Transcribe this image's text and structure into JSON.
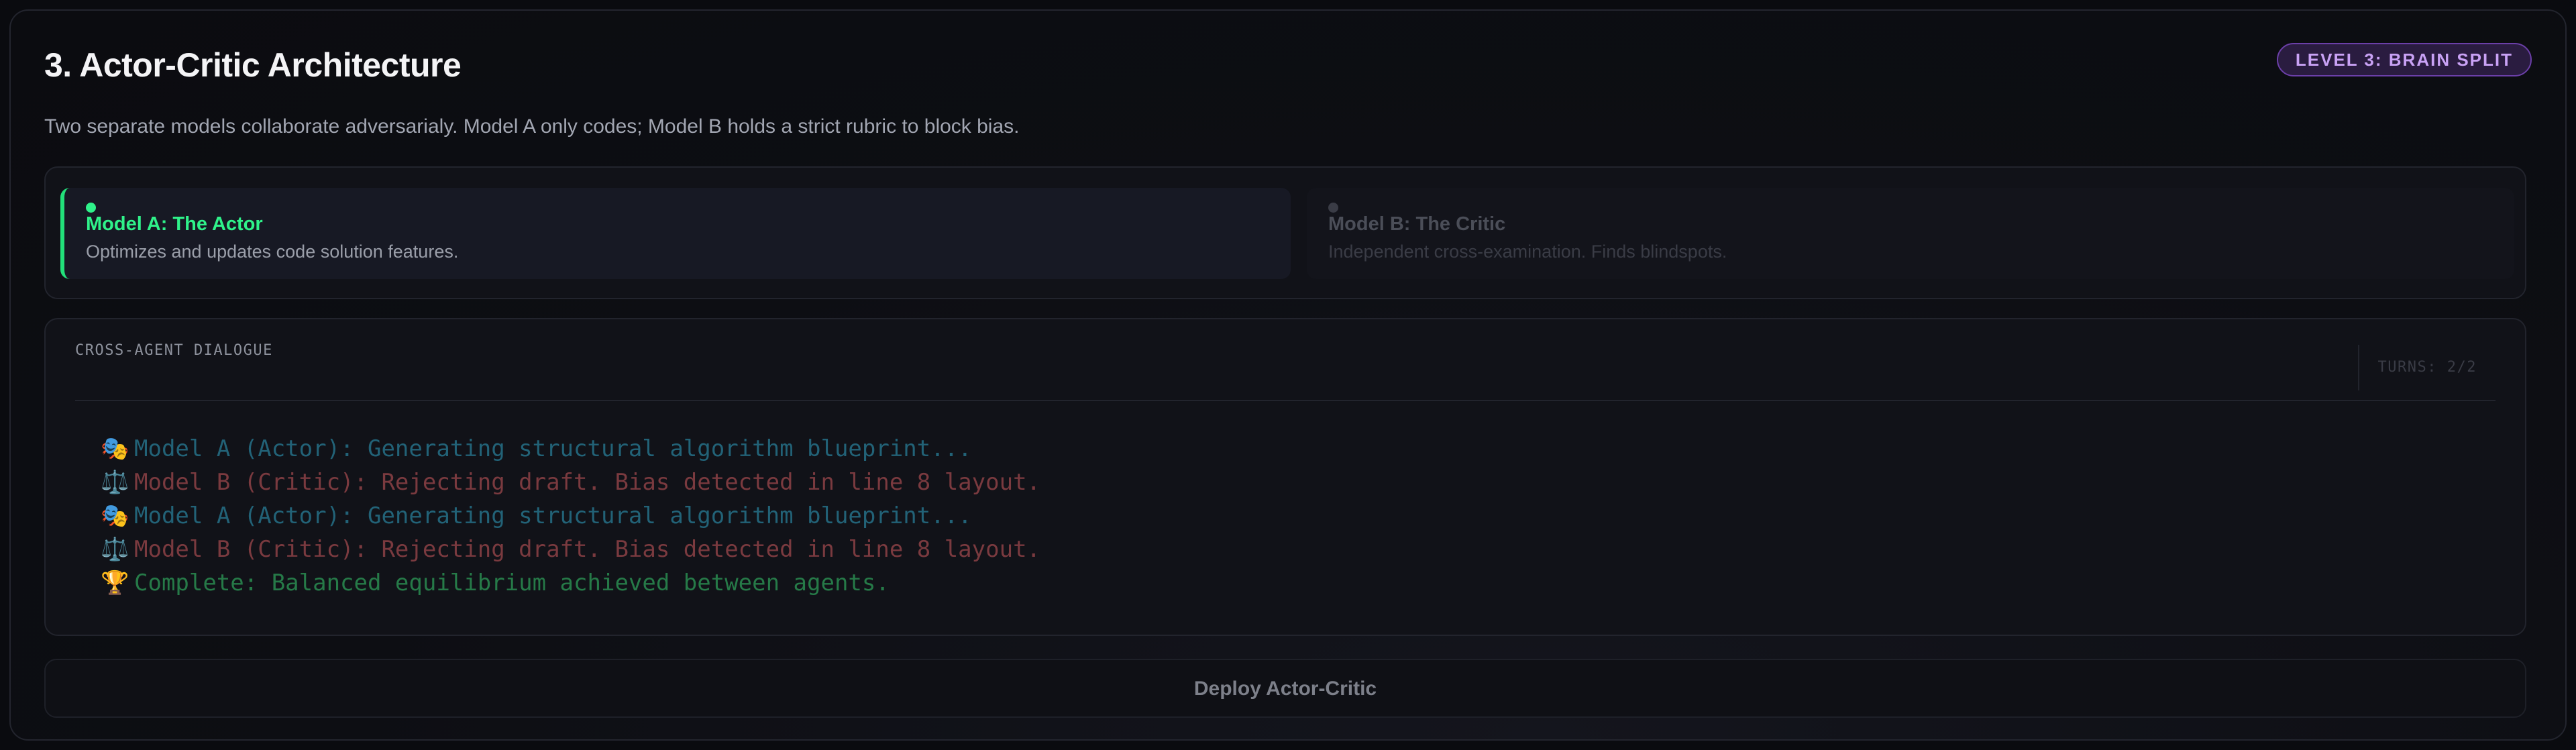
{
  "header": {
    "title": "3. Actor-Critic Architecture",
    "badge": "LEVEL 3: BRAIN SPLIT",
    "subtitle": "Two separate models collaborate adversarialy. Model A only codes; Model B holds a strict rubric to block bias."
  },
  "models": [
    {
      "name": "Model A: The Actor",
      "description": "Optimizes and updates code solution features.",
      "active": true
    },
    {
      "name": "Model B: The Critic",
      "description": "Independent cross-examination. Finds blindspots.",
      "active": false
    }
  ],
  "dialogue": {
    "label": "CROSS-AGENT DIALOGUE",
    "turns": "TURNS: 2/2",
    "lines": [
      {
        "icon": "theater-masks-icon",
        "glyph": "🎭",
        "text": "Model A (Actor): Generating structural algorithm blueprint...",
        "kind": "actor"
      },
      {
        "icon": "balance-scale-icon",
        "glyph": "⚖️",
        "text": "Model B (Critic): Rejecting draft. Bias detected in line 8 layout.",
        "kind": "critic"
      },
      {
        "icon": "theater-masks-icon",
        "glyph": "🎭",
        "text": "Model A (Actor): Generating structural algorithm blueprint...",
        "kind": "actor"
      },
      {
        "icon": "balance-scale-icon",
        "glyph": "⚖️",
        "text": "Model B (Critic): Rejecting draft. Bias detected in line 8 layout.",
        "kind": "critic"
      },
      {
        "icon": "trophy-icon",
        "glyph": "🏆",
        "text": "Complete: Balanced equilibrium achieved between agents.",
        "kind": "done"
      }
    ]
  },
  "actions": {
    "deploy_label": "Deploy Actor-Critic"
  },
  "colors": {
    "actor_accent": "#2ff28a",
    "badge_text": "#c9a2f5",
    "actor_log": "#226277",
    "critic_log": "#7a3a3f",
    "done_log": "#267a48"
  }
}
